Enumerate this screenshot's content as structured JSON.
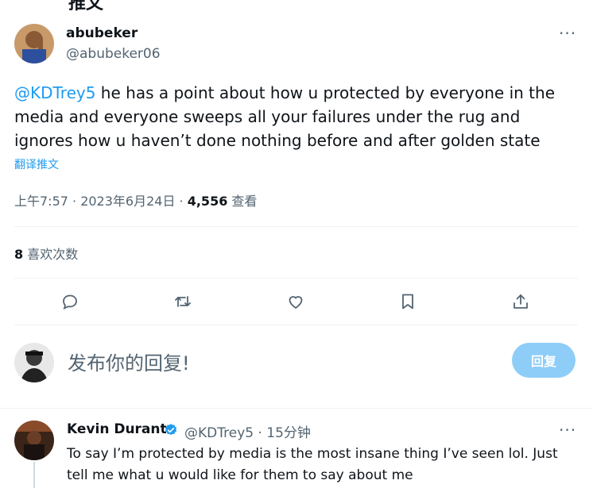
{
  "header": {
    "title": "推文"
  },
  "tweet": {
    "author_name": "abubeker",
    "author_handle": "@abubeker06",
    "mention": "@KDTrey5",
    "text": " he has a point about how u protected by everyone in the media and everyone sweeps all your failures under the rug and ignores how u haven’t done nothing before and after golden state",
    "translate_label": "翻译推文",
    "time": "上午7:57 · 2023年6月24日 · ",
    "views_count": "4,556",
    "views_label": " 查看",
    "likes_count": "8",
    "likes_label": " 喜欢次数"
  },
  "more_icon": "···",
  "actions": [
    "reply-icon",
    "retweet-icon",
    "like-icon",
    "bookmark-icon",
    "share-icon"
  ],
  "compose": {
    "placeholder": "发布你的回复!",
    "button_label": "回复"
  },
  "reply": {
    "author_name": "Kevin Durant",
    "author_handle": "@KDTrey5 · 15分钟",
    "text": "To say I’m protected by media is the most insane thing I’ve seen lol. Just tell me what u would like for them to say about me"
  },
  "colors": {
    "accent": "#1d9bf0",
    "reply_button": "#8ecdf8",
    "secondary_text": "#536471",
    "verified": "#1d9bf0"
  }
}
